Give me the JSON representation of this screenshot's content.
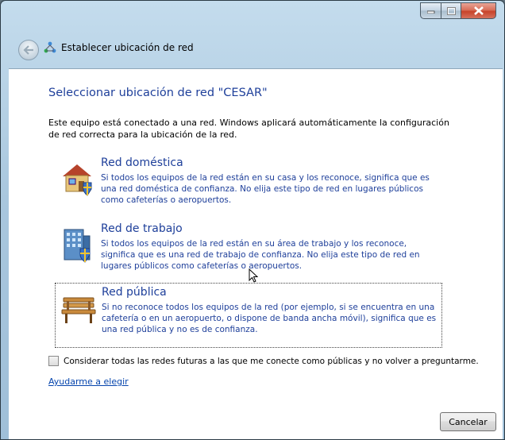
{
  "window": {
    "title": "Establecer ubicación de red",
    "controls": [
      "minimize-icon",
      "maximize-icon",
      "close-icon"
    ]
  },
  "main": {
    "heading": "Seleccionar ubicación de red \"CESAR\"",
    "intro": "Este equipo está conectado a una red. Windows aplicará automáticamente la configuración de red correcta para la ubicación de la red.",
    "options": [
      {
        "title": "Red doméstica",
        "description": "Si todos los equipos de la red están en su casa y los reconoce, significa que es una red doméstica de confianza. No elija este tipo de red en lugares públicos como cafeterías o aeropuertos.",
        "icon": "home-network-icon"
      },
      {
        "title": "Red de trabajo",
        "description": "Si todos los equipos de la red están en su área de trabajo y los reconoce, significa que es una red de trabajo de confianza. No elija este tipo de red en lugares públicos como cafeterías o aeropuertos.",
        "icon": "work-network-icon"
      },
      {
        "title": "Red pública",
        "description": "Si no reconoce todos los equipos de la red (por ejemplo, si se encuentra en una cafetería o en un aeropuerto, o dispone de banda ancha móvil), significa que es una red pública y no es de confianza.",
        "icon": "bench-icon"
      }
    ],
    "checkbox_label": "Considerar todas las redes futuras a las que me conecte como públicas y no volver a preguntarme.",
    "help_link": "Ayudarme a elegir",
    "cancel_label": "Cancelar"
  },
  "colors": {
    "link_blue": "#1e3f9a",
    "frame": "#a9c7de"
  }
}
